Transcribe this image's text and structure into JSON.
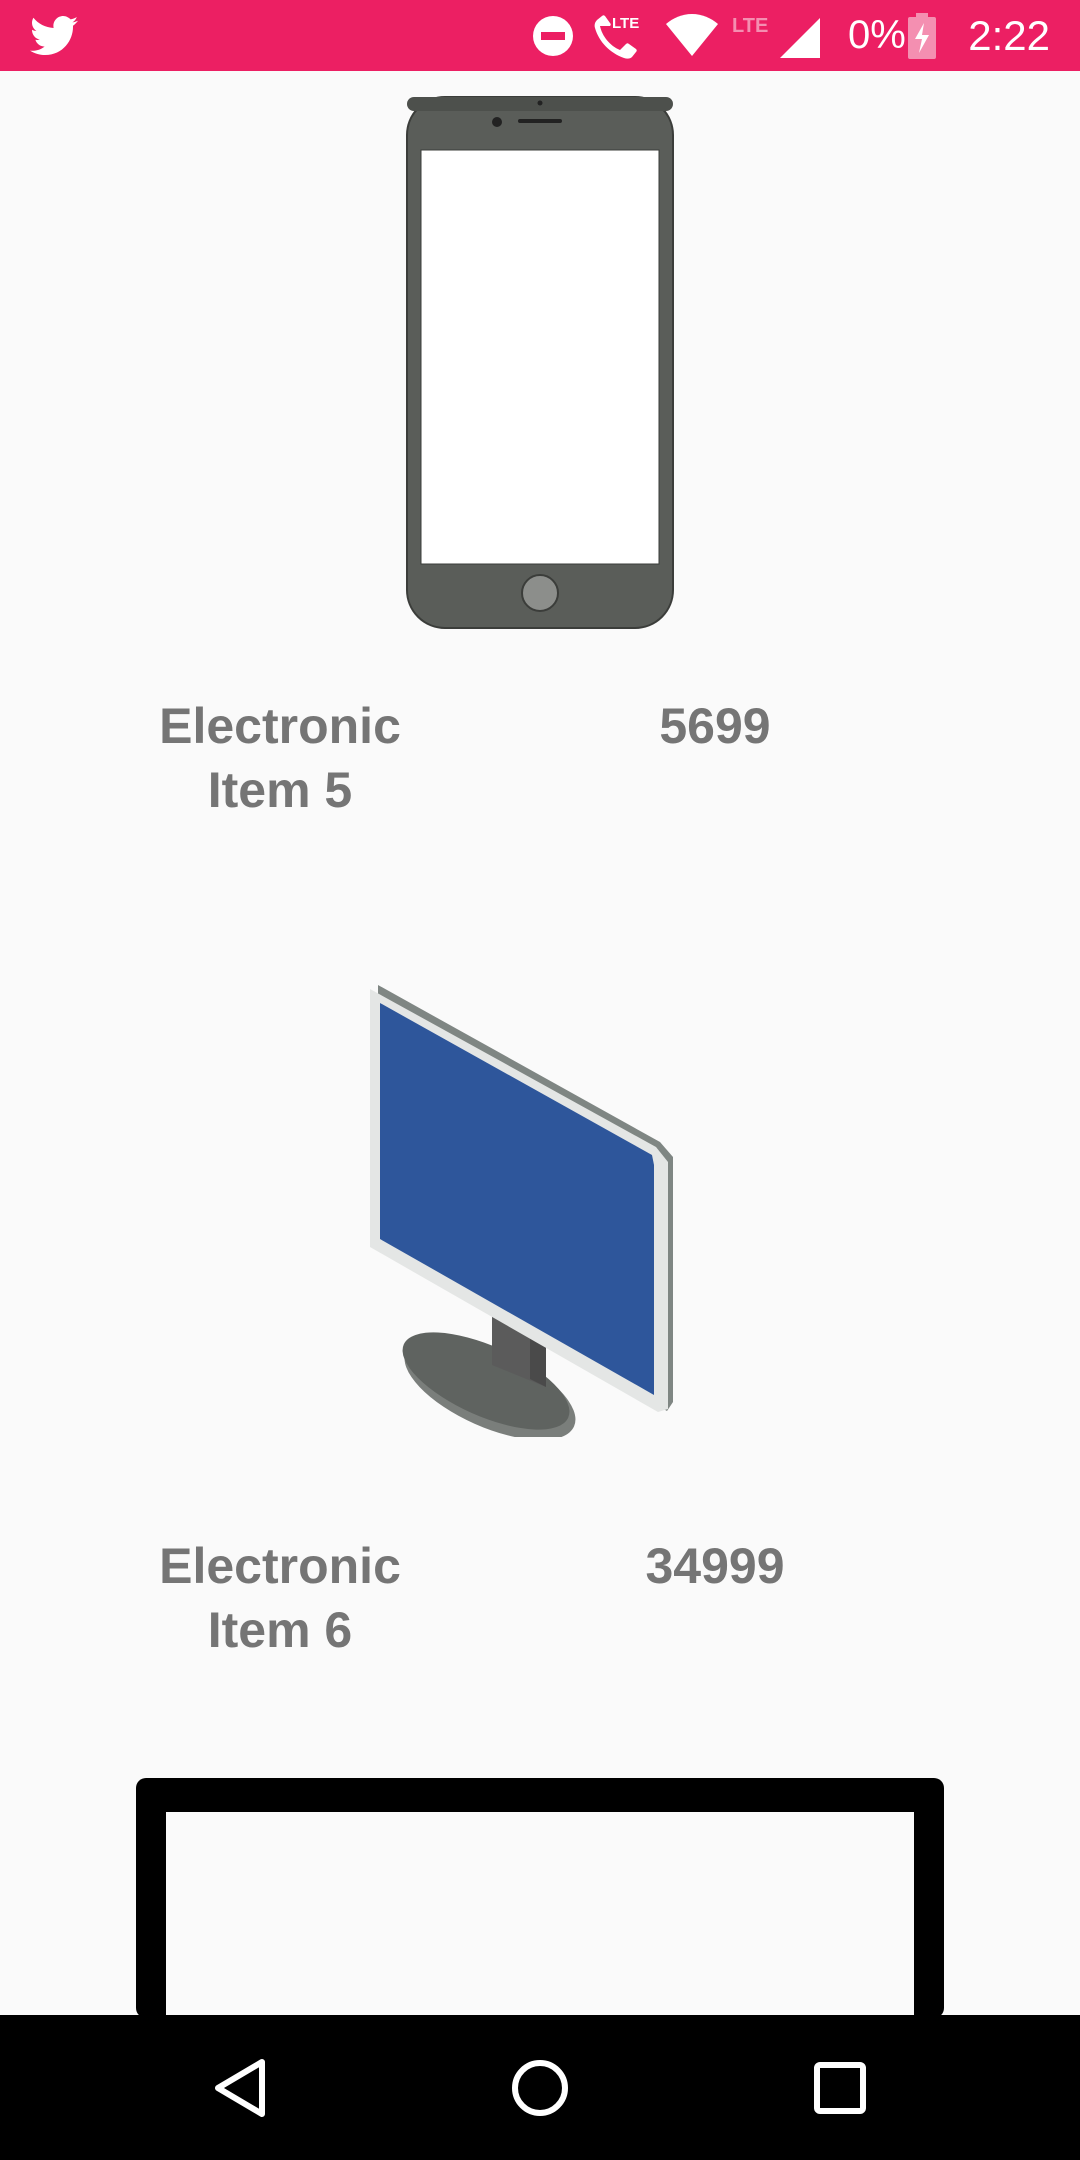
{
  "status_bar": {
    "app_icon": "twitter-icon",
    "icons": [
      "do-not-disturb-icon",
      "volte-call-icon",
      "wifi-icon",
      "lte-signal-icon",
      "battery-charging-icon"
    ],
    "lte_label": "LTE",
    "battery": "0%",
    "time": "2:22",
    "color": "#ec1f63"
  },
  "items": [
    {
      "name": "Electronic Item 5",
      "price": "5699",
      "image": "smartphone-icon"
    },
    {
      "name": "Electronic Item 6",
      "price": "34999",
      "image": "monitor-icon"
    },
    {
      "image": "tv-icon"
    }
  ],
  "nav_bar": {
    "buttons": [
      "back-icon",
      "home-icon",
      "recents-icon"
    ]
  }
}
